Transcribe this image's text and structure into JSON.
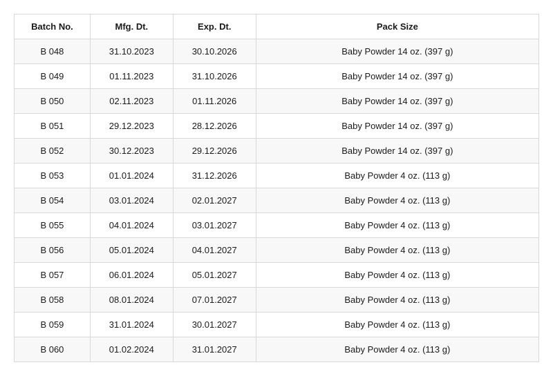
{
  "headers": {
    "batch": "Batch No.",
    "mfg": "Mfg. Dt.",
    "exp": "Exp. Dt.",
    "pack": "Pack Size"
  },
  "rows": [
    {
      "batch": "B 048",
      "mfg": "31.10.2023",
      "exp": "30.10.2026",
      "pack": "Baby Powder 14 oz. (397 g)"
    },
    {
      "batch": "B 049",
      "mfg": "01.11.2023",
      "exp": "31.10.2026",
      "pack": "Baby Powder 14 oz. (397 g)"
    },
    {
      "batch": "B 050",
      "mfg": "02.11.2023",
      "exp": "01.11.2026",
      "pack": "Baby Powder 14 oz. (397 g)"
    },
    {
      "batch": "B 051",
      "mfg": "29.12.2023",
      "exp": "28.12.2026",
      "pack": "Baby Powder 14 oz. (397 g)"
    },
    {
      "batch": "B 052",
      "mfg": "30.12.2023",
      "exp": "29.12.2026",
      "pack": "Baby Powder 14 oz. (397 g)"
    },
    {
      "batch": "B 053",
      "mfg": "01.01.2024",
      "exp": "31.12.2026",
      "pack": "Baby Powder 4 oz. (113 g)"
    },
    {
      "batch": "B 054",
      "mfg": "03.01.2024",
      "exp": "02.01.2027",
      "pack": "Baby Powder 4 oz. (113 g)"
    },
    {
      "batch": "B 055",
      "mfg": "04.01.2024",
      "exp": "03.01.2027",
      "pack": "Baby Powder 4 oz. (113 g)"
    },
    {
      "batch": "B 056",
      "mfg": "05.01.2024",
      "exp": "04.01.2027",
      "pack": "Baby Powder 4 oz. (113 g)"
    },
    {
      "batch": "B 057",
      "mfg": "06.01.2024",
      "exp": "05.01.2027",
      "pack": "Baby Powder 4 oz. (113 g)"
    },
    {
      "batch": "B 058",
      "mfg": "08.01.2024",
      "exp": "07.01.2027",
      "pack": "Baby Powder 4 oz. (113 g)"
    },
    {
      "batch": "B 059",
      "mfg": "31.01.2024",
      "exp": "30.01.2027",
      "pack": "Baby Powder 4 oz. (113 g)"
    },
    {
      "batch": "B 060",
      "mfg": "01.02.2024",
      "exp": "31.01.2027",
      "pack": "Baby Powder 4 oz. (113 g)"
    }
  ]
}
